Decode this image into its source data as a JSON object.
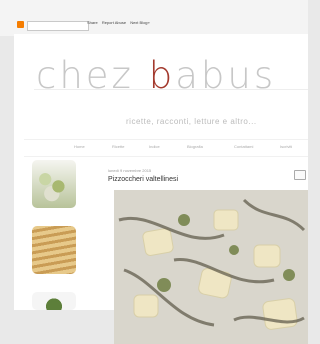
{
  "navbar": {
    "search_value": "",
    "links": [
      "Share",
      "Report Abuse",
      "Next Blog»"
    ]
  },
  "blog": {
    "title_prefix": "chez ",
    "title_accent": "b",
    "title_suffix": "abus",
    "tagline": "ricette, racconti, letture e altro...",
    "nav": [
      "Home",
      "Ricette",
      "Indice",
      "Biografia",
      "Contattami",
      "Iscriviti"
    ]
  },
  "post": {
    "date": "lunedì 9 novembre 2015",
    "title": "Pizzoccheri valtellinesi"
  },
  "colors": {
    "accent": "#a33a2e",
    "navbar_logo": "#f57d00"
  }
}
